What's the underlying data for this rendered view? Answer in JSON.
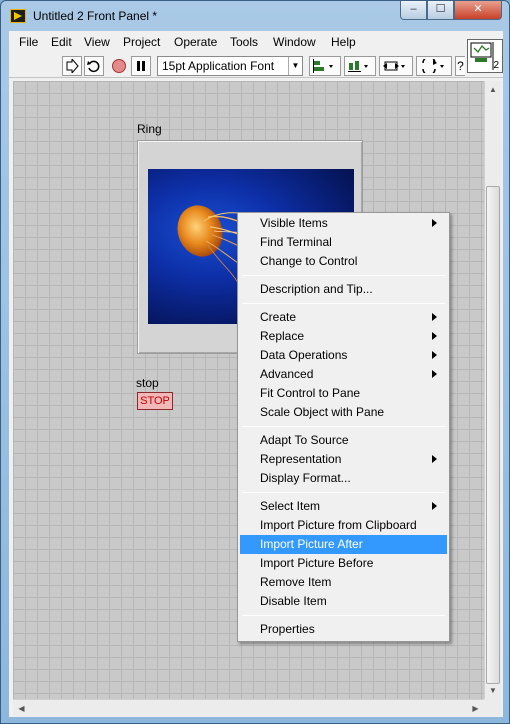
{
  "window": {
    "title": "Untitled 2 Front Panel *",
    "min_label": "–",
    "max_label": "☐",
    "close_label": "✕"
  },
  "menubar": [
    {
      "id": "file",
      "label": "File"
    },
    {
      "id": "edit",
      "label": "Edit"
    },
    {
      "id": "view",
      "label": "View"
    },
    {
      "id": "project",
      "label": "Project"
    },
    {
      "id": "operate",
      "label": "Operate"
    },
    {
      "id": "tools",
      "label": "Tools"
    },
    {
      "id": "window",
      "label": "Window"
    },
    {
      "id": "help",
      "label": "Help"
    }
  ],
  "toolbar": {
    "font": "15pt Application Font",
    "connector_pane_number": "2"
  },
  "panel": {
    "ring_label": "Ring",
    "stop_label": "stop",
    "stop_button_text": "STOP"
  },
  "context_menu": {
    "groups": [
      [
        {
          "label": "Visible Items",
          "submenu": true
        },
        {
          "label": "Find Terminal",
          "submenu": false
        },
        {
          "label": "Change to Control",
          "submenu": false
        }
      ],
      [
        {
          "label": "Description and Tip...",
          "submenu": false
        }
      ],
      [
        {
          "label": "Create",
          "submenu": true
        },
        {
          "label": "Replace",
          "submenu": true
        },
        {
          "label": "Data Operations",
          "submenu": true
        },
        {
          "label": "Advanced",
          "submenu": true
        },
        {
          "label": "Fit Control to Pane",
          "submenu": false
        },
        {
          "label": "Scale Object with Pane",
          "submenu": false
        }
      ],
      [
        {
          "label": "Adapt To Source",
          "submenu": false
        },
        {
          "label": "Representation",
          "submenu": true
        },
        {
          "label": "Display Format...",
          "submenu": false
        }
      ],
      [
        {
          "label": "Select Item",
          "submenu": true
        },
        {
          "label": "Import Picture from Clipboard",
          "submenu": false
        },
        {
          "label": "Import Picture After",
          "submenu": false,
          "highlighted": true
        },
        {
          "label": "Import Picture Before",
          "submenu": false
        },
        {
          "label": "Remove Item",
          "submenu": false
        },
        {
          "label": "Disable Item",
          "submenu": false
        }
      ],
      [
        {
          "label": "Properties",
          "submenu": false
        }
      ]
    ]
  },
  "colors": {
    "highlight": "#3399ff",
    "stop_text": "#c00000",
    "canvas": "#c9c9c9"
  }
}
